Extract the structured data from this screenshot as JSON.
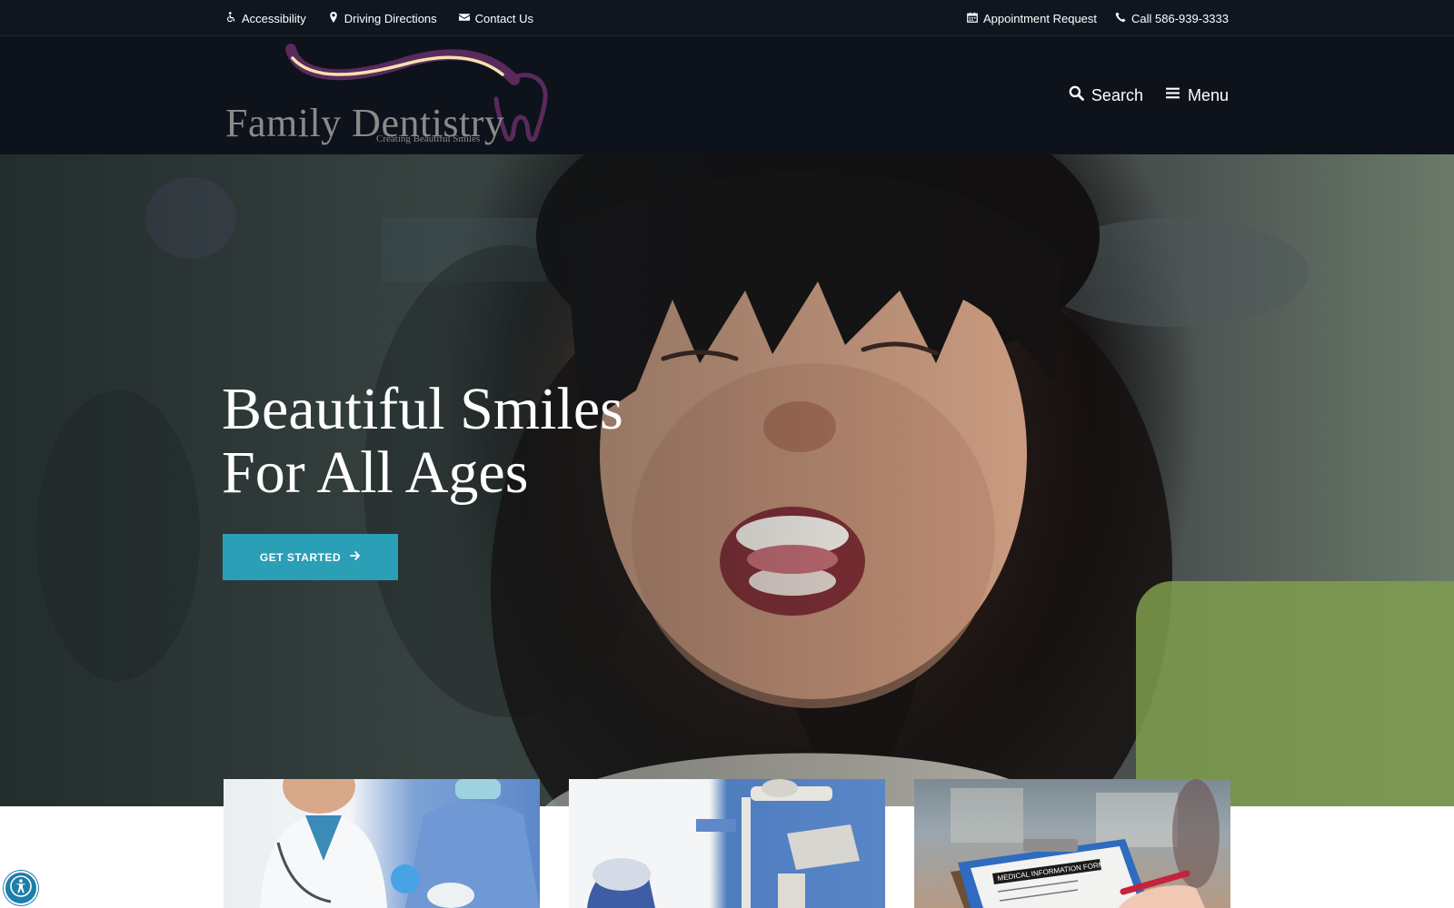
{
  "utility": {
    "left": [
      {
        "label": "Accessibility",
        "icon": "wheelchair-icon"
      },
      {
        "label": "Driving Directions",
        "icon": "map-marker-icon"
      },
      {
        "label": "Contact Us",
        "icon": "envelope-icon"
      }
    ],
    "right": [
      {
        "label": "Appointment Request",
        "icon": "calendar-icon"
      },
      {
        "label": "Call 586-939-3333",
        "icon": "phone-icon"
      }
    ]
  },
  "header": {
    "logo_name": "Family Dentistry",
    "logo_tagline": "Creating Beautiful Smiles",
    "search_label": "Search",
    "menu_label": "Menu"
  },
  "hero": {
    "title_line1": "Beautiful Smiles",
    "title_line2": "For All Ages",
    "cta_label": "GET STARTED"
  },
  "cards": [
    {
      "image": "dentists-with-patient-photo"
    },
    {
      "image": "dental-chair-photo"
    },
    {
      "image": "medical-information-form-photo",
      "form_text": "MEDICAL INFORMATION FORM"
    }
  ],
  "colors": {
    "header_bg": "#0d121b",
    "utility_bg": "#101620",
    "accent": "#2a9fb5",
    "logo_purple": "#5a2a5c",
    "logo_gold": "#f3e3b0"
  }
}
